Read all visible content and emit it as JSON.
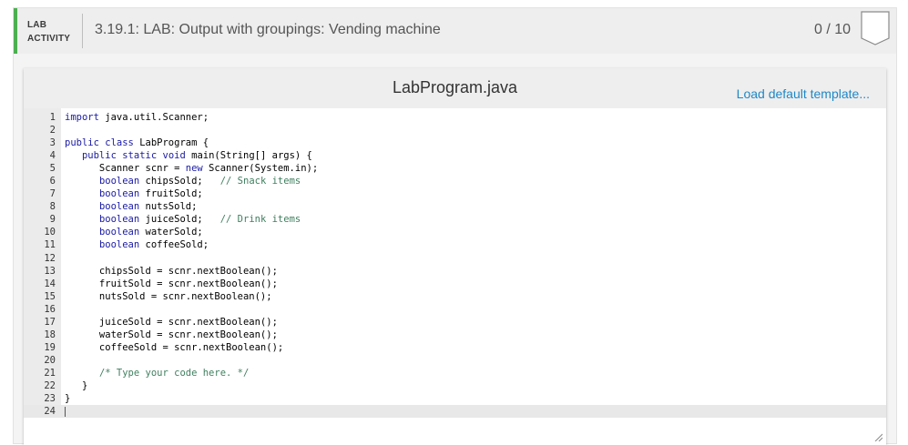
{
  "header": {
    "badge_line1": "LAB",
    "badge_line2": "ACTIVITY",
    "title": "3.19.1: LAB: Output with groupings: Vending machine",
    "score": "0 / 10",
    "accent_color": "#4caf50"
  },
  "editor": {
    "filename": "LabProgram.java",
    "load_default_label": "Load default template...",
    "lines": [
      "import java.util.Scanner;",
      "",
      "public class LabProgram {",
      "   public static void main(String[] args) {",
      "      Scanner scnr = new Scanner(System.in);",
      "      boolean chipsSold;   // Snack items",
      "      boolean fruitSold;",
      "      boolean nutsSold;",
      "      boolean juiceSold;   // Drink items",
      "      boolean waterSold;",
      "      boolean coffeeSold;",
      "",
      "      chipsSold = scnr.nextBoolean();",
      "      fruitSold = scnr.nextBoolean();",
      "      nutsSold = scnr.nextBoolean();",
      "",
      "      juiceSold = scnr.nextBoolean();",
      "      waterSold = scnr.nextBoolean();",
      "      coffeeSold = scnr.nextBoolean();",
      "",
      "      /* Type your code here. */",
      "   }",
      "}",
      ""
    ],
    "active_line": 24
  }
}
